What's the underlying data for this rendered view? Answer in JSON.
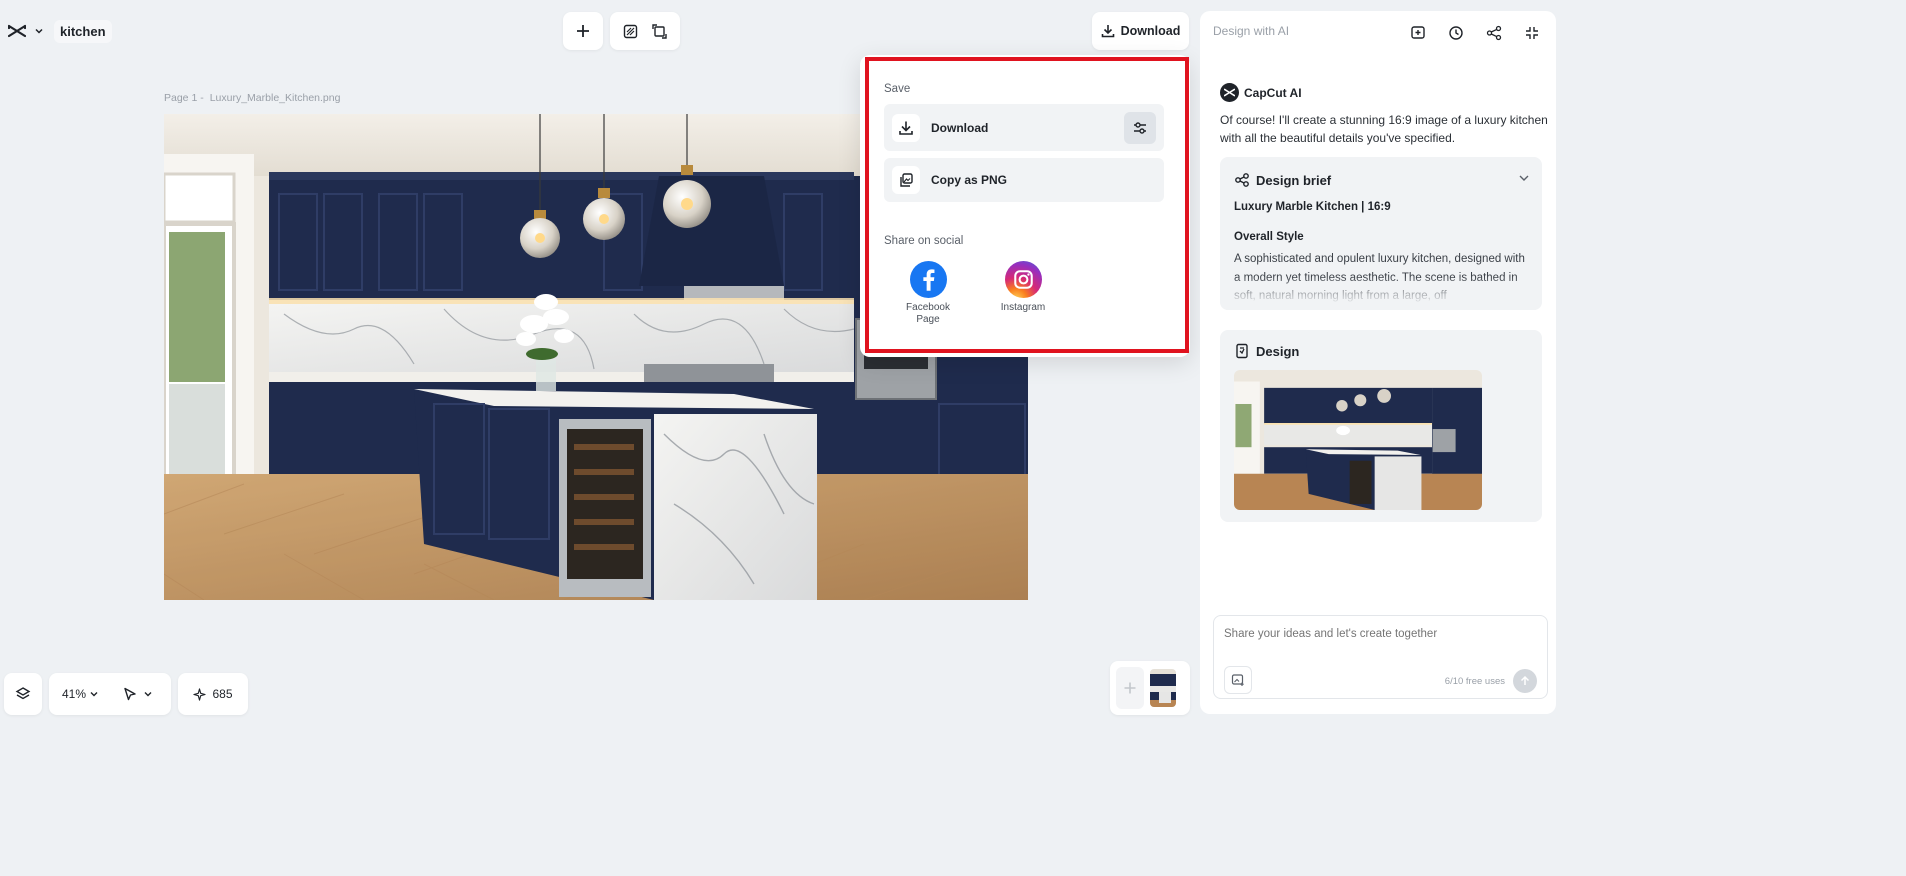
{
  "header": {
    "project_name": "kitchen",
    "download_label": "Download"
  },
  "canvas": {
    "page_label": "Page 1 -",
    "file_name": "Luxury_Marble_Kitchen.png"
  },
  "download_popover": {
    "save_heading": "Save",
    "download_label": "Download",
    "copy_label": "Copy as PNG",
    "social_heading": "Share on social",
    "social": [
      {
        "name": "Facebook Page",
        "icon": "facebook-icon",
        "color": "#1877f2"
      },
      {
        "name": "Instagram",
        "icon": "instagram-icon"
      }
    ],
    "highlight_color": "#e0131f"
  },
  "ai_panel": {
    "title": "Design with AI",
    "author": "CapCut AI",
    "message": "Of course! I'll create a stunning 16:9 image of a luxury kitchen with all the beautiful details you've specified.",
    "brief": {
      "title": "Design brief",
      "subtitle": "Luxury Marble Kitchen | 16:9",
      "section_title": "Overall Style",
      "text": "A sophisticated and opulent luxury kitchen, designed with a modern yet timeless aesthetic. The scene is bathed in soft, natural morning light from a large, off"
    },
    "design": {
      "title": "Design"
    },
    "prompt": {
      "placeholder": "Share your ideas and let's create together",
      "usage": "6/10 free uses"
    }
  },
  "bottom_bar": {
    "zoom": "41%",
    "credits": "685"
  },
  "colors": {
    "background": "#eef1f4",
    "cabinet_navy": "#1f2b4d",
    "accent_red": "#e0131f"
  }
}
